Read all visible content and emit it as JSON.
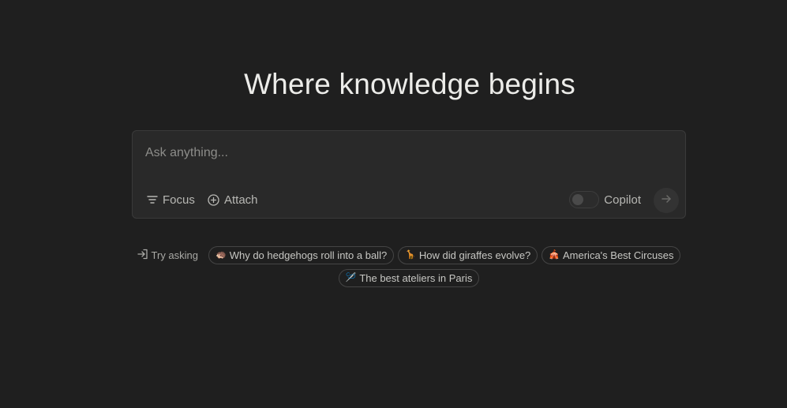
{
  "headline": "Where knowledge begins",
  "search": {
    "placeholder": "Ask anything...",
    "value": ""
  },
  "toolbar": {
    "focus_label": "Focus",
    "attach_label": "Attach",
    "copilot_label": "Copilot",
    "copilot_enabled": false
  },
  "suggestions": {
    "label": "Try asking",
    "items": [
      {
        "emoji": "🦔",
        "text": "Why do hedgehogs roll into a ball?"
      },
      {
        "emoji": "🦒",
        "text": "How did giraffes evolve?"
      },
      {
        "emoji": "🎪",
        "text": "America's Best Circuses"
      },
      {
        "emoji": "🪡",
        "text": "The best ateliers in Paris"
      }
    ]
  }
}
